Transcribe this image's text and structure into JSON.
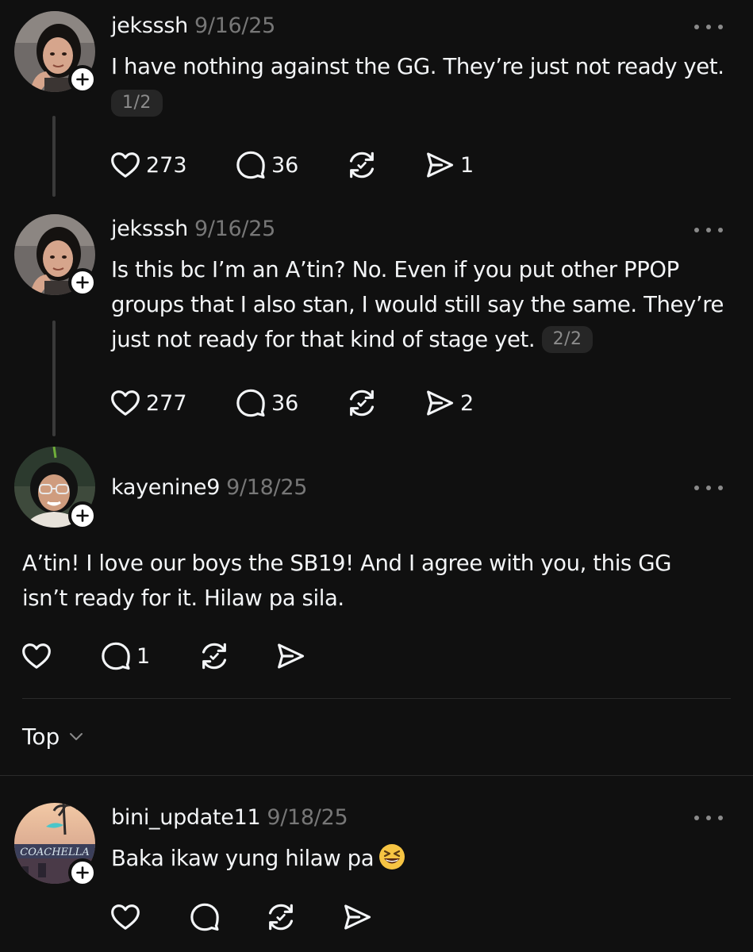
{
  "posts": [
    {
      "username": "jeksssh",
      "date": "9/16/25",
      "text": "I have nothing against the GG. They’re just not ready yet.",
      "pager": "1/2",
      "likes": "273",
      "replies": "36",
      "shares": "1"
    },
    {
      "username": "jeksssh",
      "date": "9/16/25",
      "text": "Is this bc I’m an A’tin? No. Even if you put other PPOP groups that I also stan, I would still say the same. They’re just not ready for that kind of stage yet.",
      "pager": "2/2",
      "likes": "277",
      "replies": "36",
      "shares": "2"
    },
    {
      "username": "kayenine9",
      "date": "9/18/25",
      "text": "A’tin! I love our boys the SB19! And I agree with you, this GG isn’t ready for it. Hilaw pa sila.",
      "replies": "1"
    },
    {
      "username": "bini_update11",
      "date": "9/18/25",
      "text": "Baka ikaw yung hilaw pa",
      "avatar_text": "COACHELLA"
    }
  ],
  "sort": {
    "label": "Top"
  },
  "icons": {
    "like": "heart-icon",
    "reply": "comment-icon",
    "repost": "repost-icon",
    "share": "send-icon",
    "more": "more-icon",
    "follow": "plus-icon",
    "emoji": "grinning-squinting-face-emoji"
  },
  "colors": {
    "background": "#101010",
    "text": "#f3f5f7",
    "muted": "#777777"
  }
}
